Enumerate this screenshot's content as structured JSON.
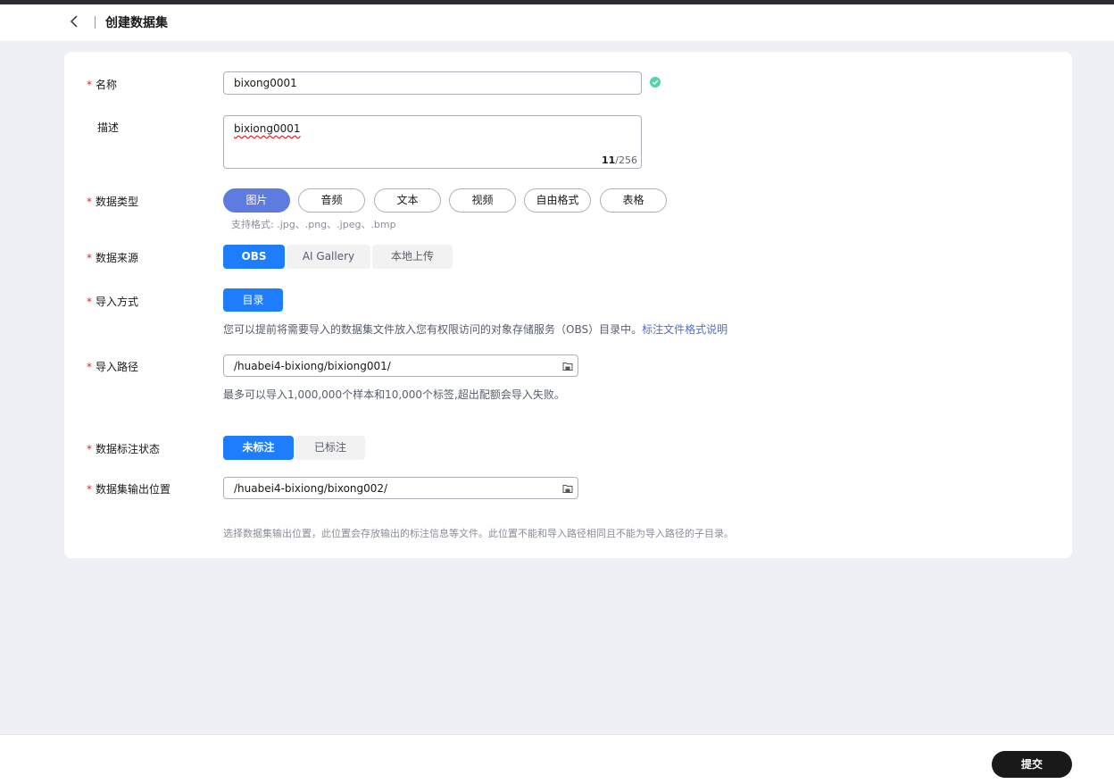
{
  "header": {
    "title": "创建数据集"
  },
  "form": {
    "name": {
      "label": "名称",
      "value": "bixong0001"
    },
    "description": {
      "label": "描述",
      "value": "bixiong0001",
      "count_current": "11",
      "count_total": "/256"
    },
    "data_type": {
      "label": "数据类型",
      "options": [
        "图片",
        "音频",
        "文本",
        "视频",
        "自由格式",
        "表格"
      ],
      "hint": "支持格式: .jpg、.png、.jpeg、.bmp"
    },
    "data_source": {
      "label": "数据来源",
      "options": [
        "OBS",
        "AI Gallery",
        "本地上传"
      ]
    },
    "import_method": {
      "label": "导入方式",
      "option": "目录",
      "desc": "您可以提前将需要导入的数据集文件放入您有权限访问的对象存储服务（OBS）目录中。",
      "link": "标注文件格式说明"
    },
    "import_path": {
      "label": "导入路径",
      "value": "/huabei4-bixiong/bixiong001/",
      "hint": "最多可以导入1,000,000个样本和10,000个标签,超出配额会导入失败。"
    },
    "label_status": {
      "label": "数据标注状态",
      "options": [
        "未标注",
        "已标注"
      ]
    },
    "output_path": {
      "label": "数据集输出位置",
      "value": "/huabei4-bixiong/bixong002/",
      "hint": "选择数据集输出位置，此位置会存放输出的标注信息等文件。此位置不能和导入路径相同且不能为导入路径的子目录。"
    }
  },
  "footer": {
    "submit": "提交"
  },
  "colors": {
    "primary": "#1e7dfc",
    "pill_active": "#5e7ce0",
    "required": "#e0262d",
    "success": "#50d4ab"
  }
}
